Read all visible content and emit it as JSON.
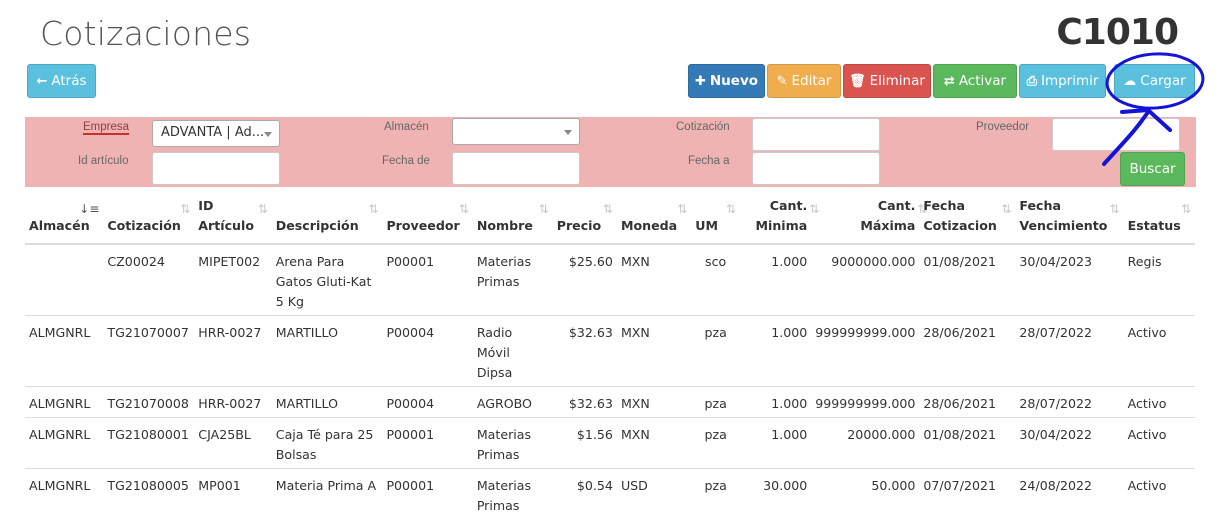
{
  "header": {
    "title": "Cotizaciones",
    "code": "C1010"
  },
  "toolbar": {
    "back": "Atrás",
    "new": "Nuevo",
    "edit": "Editar",
    "delete": "Eliminar",
    "activate": "Activar",
    "print": "Imprimir",
    "load": "Cargar"
  },
  "filters": {
    "empresa_label": "Empresa",
    "empresa_value": "ADVANTA | Ad...",
    "almacen_label": "Almacén",
    "almacen_value": "",
    "cotizacion_label": "Cotización",
    "proveedor_label": "Proveedor",
    "articulo_label": "Id artículo",
    "fecha_de_label": "Fecha de",
    "fecha_a_label": "Fecha a",
    "search": "Buscar"
  },
  "table": {
    "headers": {
      "almacen": "Almacén",
      "cotizacion": "Cotización",
      "id_articulo_1": "ID",
      "id_articulo_2": "Artículo",
      "descripcion": "Descripción",
      "proveedor": "Proveedor",
      "nombre": "Nombre",
      "precio": "Precio",
      "moneda": "Moneda",
      "um": "UM",
      "cant_min_1": "Cant.",
      "cant_min_2": "Minima",
      "cant_max_1": "Cant.",
      "cant_max_2": "Máxima",
      "fecha_cot_1": "Fecha",
      "fecha_cot_2": "Cotizacion",
      "fecha_venc_1": "Fecha",
      "fecha_venc_2": "Vencimiento",
      "estatus": "Estatus"
    },
    "rows": [
      {
        "almacen": "",
        "cotizacion": "CZ00024",
        "articulo": "MIPET002",
        "descripcion": "Arena Para Gatos Gluti-Kat 5 Kg",
        "proveedor": "P00001",
        "nombre": "Materias Primas",
        "precio": "$25.60",
        "moneda": "MXN",
        "um": "sco",
        "min": "1.000",
        "max": "9000000.000",
        "fecha_cot": "01/08/2021",
        "fecha_venc": "30/04/2023",
        "estatus": "Regis"
      },
      {
        "almacen": "ALMGNRL",
        "cotizacion": "TG21070007",
        "articulo": "HRR-0027",
        "descripcion": "MARTILLO",
        "proveedor": "P00004",
        "nombre": "Radio Móvil Dipsa",
        "precio": "$32.63",
        "moneda": "MXN",
        "um": "pza",
        "min": "1.000",
        "max": "999999999.000",
        "fecha_cot": "28/06/2021",
        "fecha_venc": "28/07/2022",
        "estatus": "Activo"
      },
      {
        "almacen": "ALMGNRL",
        "cotizacion": "TG21070008",
        "articulo": "HRR-0027",
        "descripcion": "MARTILLO",
        "proveedor": "P00004",
        "nombre": "AGROBO",
        "precio": "$32.63",
        "moneda": "MXN",
        "um": "pza",
        "min": "1.000",
        "max": "999999999.000",
        "fecha_cot": "28/06/2021",
        "fecha_venc": "28/07/2022",
        "estatus": "Activo"
      },
      {
        "almacen": "ALMGNRL",
        "cotizacion": "TG21080001",
        "articulo": "CJA25BL",
        "descripcion": "Caja Té para 25 Bolsas",
        "proveedor": "P00001",
        "nombre": "Materias Primas",
        "precio": "$1.56",
        "moneda": "MXN",
        "um": "pza",
        "min": "1.000",
        "max": "20000.000",
        "fecha_cot": "01/08/2021",
        "fecha_venc": "30/04/2022",
        "estatus": "Activo"
      },
      {
        "almacen": "ALMGNRL",
        "cotizacion": "TG21080005",
        "articulo": "MP001",
        "descripcion": "Materia Prima A",
        "proveedor": "P00001",
        "nombre": "Materias Primas",
        "precio": "$0.54",
        "moneda": "USD",
        "um": "pza",
        "min": "30.000",
        "max": "50.000",
        "fecha_cot": "07/07/2021",
        "fecha_venc": "24/08/2022",
        "estatus": "Activo"
      }
    ]
  },
  "colors": {
    "filter_bg": "#f0b3b3",
    "primary": "#337ab7",
    "info": "#5bc0de",
    "success": "#5cb85c",
    "warning": "#f0ad4e",
    "danger": "#d9534f",
    "annotation": "#1414d6"
  }
}
